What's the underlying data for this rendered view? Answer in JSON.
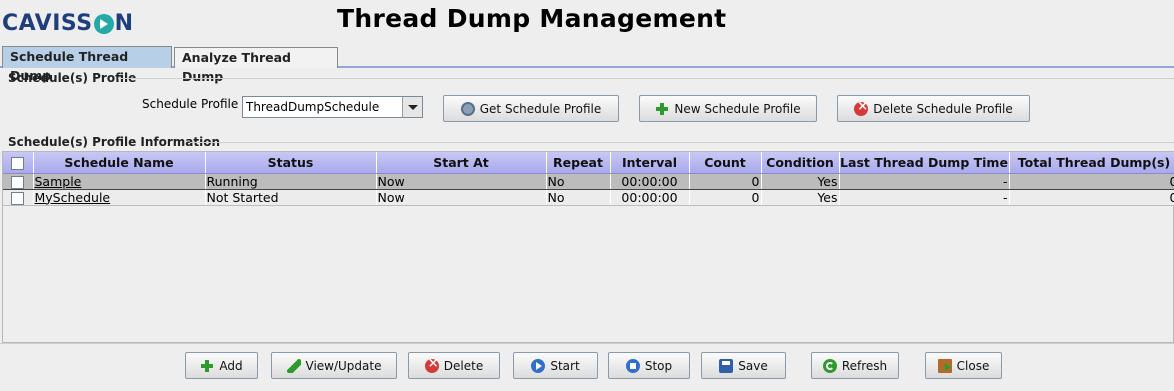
{
  "header": {
    "logo_left": "CAVISS",
    "logo_right": "N",
    "title": "Thread Dump Management"
  },
  "tabs": [
    {
      "label": "Schedule Thread Dump",
      "active": true
    },
    {
      "label": "Analyze Thread Dump",
      "active": false
    }
  ],
  "profile_section": {
    "heading": "Schedule(s) Profile",
    "field_label": "Schedule Profile",
    "selected_profile": "ThreadDumpSchedule",
    "buttons": {
      "get": "Get Schedule Profile",
      "new": "New Schedule Profile",
      "delete": "Delete Schedule Profile"
    }
  },
  "info_section": {
    "heading": "Schedule(s) Profile Information"
  },
  "table": {
    "columns": [
      "",
      "Schedule Name",
      "Status",
      "Start At",
      "Repeat",
      "Interval",
      "Count",
      "Condition",
      "Last Thread Dump Time",
      "Total Thread Dump(s)"
    ],
    "rows": [
      {
        "name": "Sample",
        "status": "Running",
        "start_at": "Now",
        "repeat": "No",
        "interval": "00:00:00",
        "count": "0",
        "condition": "Yes",
        "last_time": "-",
        "total": "0"
      },
      {
        "name": "MySchedule",
        "status": "Not Started",
        "start_at": "Now",
        "repeat": "No",
        "interval": "00:00:00",
        "count": "0",
        "condition": "Yes",
        "last_time": "-",
        "total": "0"
      }
    ]
  },
  "footer_buttons": {
    "add": "Add",
    "view_update": "View/Update",
    "delete": "Delete",
    "start": "Start",
    "stop": "Stop",
    "save": "Save",
    "refresh": "Refresh",
    "close": "Close"
  },
  "colors": {
    "brand": "#1f3f7a",
    "brand_accent": "#27a8a8",
    "table_header": "#a9a9ee",
    "active_tab": "#b8cfe8",
    "selected_row": "#bcbcbc"
  }
}
